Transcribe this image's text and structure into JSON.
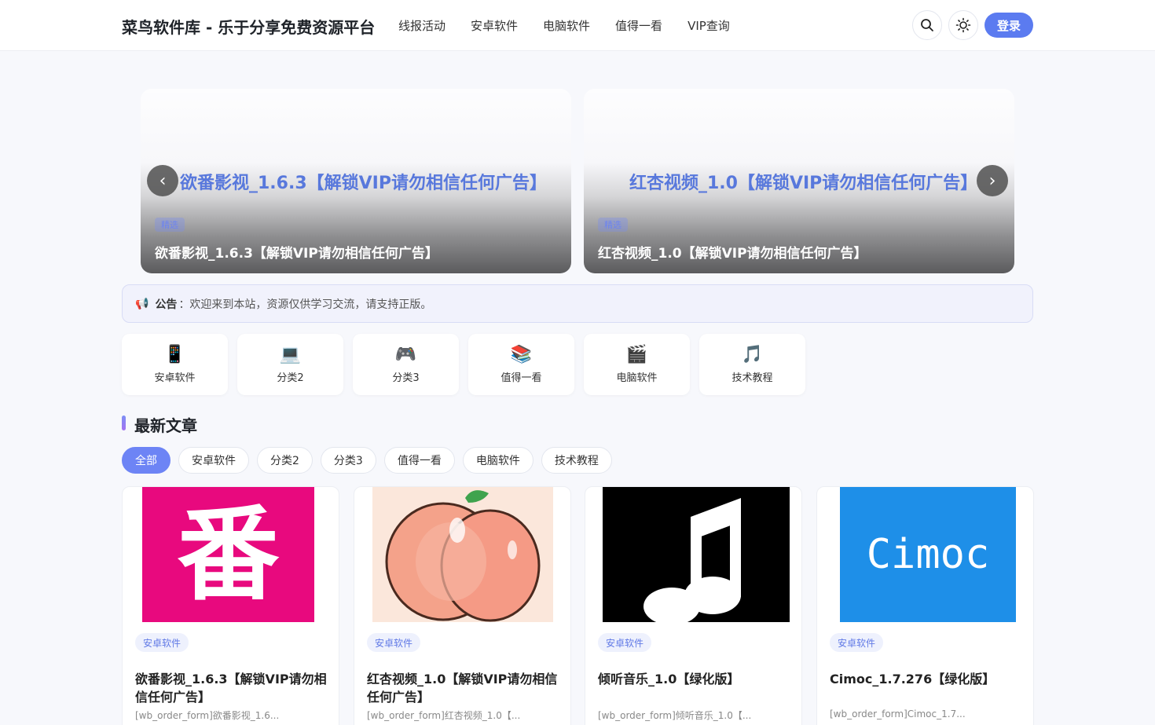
{
  "header": {
    "site_title": "菜鸟软件库 - 乐于分享免费资源平台",
    "nav": [
      "线报活动",
      "安卓软件",
      "电脑软件",
      "值得一看",
      "VIP查询"
    ],
    "login_label": "登录"
  },
  "carousel": [
    {
      "headline": "欲番影视_1.6.3【解锁VIP请勿相信任何广告】",
      "tag": "精选",
      "caption": "欲番影视_1.6.3【解锁VIP请勿相信任何广告】"
    },
    {
      "headline": "红杏视频_1.0【解锁VIP请勿相信任何广告】",
      "tag": "精选",
      "caption": "红杏视频_1.0【解锁VIP请勿相信任何广告】"
    }
  ],
  "carousel_prev": "‹",
  "carousel_next": "›",
  "notice": {
    "icon": "📢",
    "label": "公告",
    "text": "：欢迎来到本站，资源仅供学习交流，请支持正版。"
  },
  "categories": [
    {
      "icon": "📱",
      "name": "安卓软件"
    },
    {
      "icon": "💻",
      "name": "分类2"
    },
    {
      "icon": "🎮",
      "name": "分类3"
    },
    {
      "icon": "📚",
      "name": "值得一看"
    },
    {
      "icon": "🎬",
      "name": "电脑软件"
    },
    {
      "icon": "🎵",
      "name": "技术教程"
    }
  ],
  "section_title": "最新文章",
  "filter_tabs": [
    "全部",
    "安卓软件",
    "分类2",
    "分类3",
    "值得一看",
    "电脑软件",
    "技术教程"
  ],
  "articles": [
    {
      "thumb_text": "番",
      "tag": "安卓软件",
      "title": "欲番影视_1.6.3【解锁VIP请勿相信任何广告】",
      "excerpt": "[wb_order_form]欲番影视_1.6..."
    },
    {
      "thumb_text": "",
      "tag": "安卓软件",
      "title": "红杏视频_1.0【解锁VIP请勿相信任何广告】",
      "excerpt": "[wb_order_form]红杏视频_1.0【..."
    },
    {
      "thumb_text": "",
      "tag": "安卓软件",
      "title": "倾听音乐_1.0【绿化版】",
      "excerpt": "[wb_order_form]倾听音乐_1.0【..."
    },
    {
      "thumb_text": "Cimoc",
      "tag": "安卓软件",
      "title": "Cimoc_1.7.276【绿化版】",
      "excerpt": "[wb_order_form]Cimoc_1.7..."
    }
  ],
  "colors": {
    "accent": "#5b7bf0",
    "tag_bg": "#eef1fd",
    "thumb1": "#e8097e",
    "thumb4": "#1e8fe8"
  }
}
